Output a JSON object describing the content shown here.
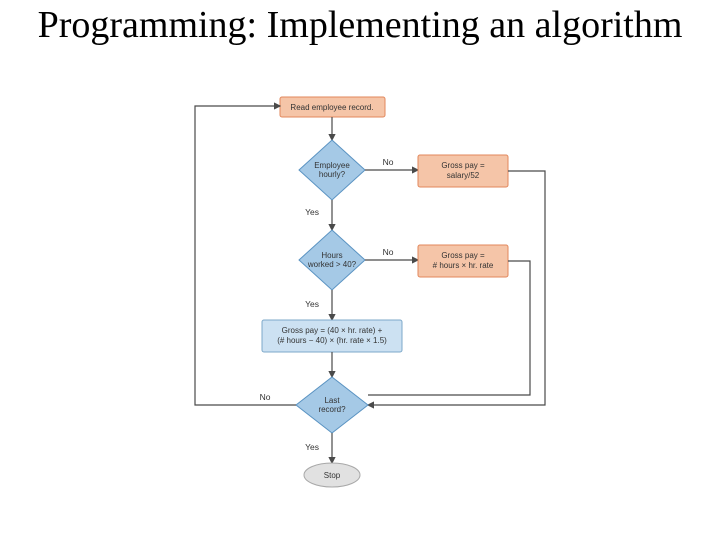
{
  "title": "Programming: Implementing an algorithm",
  "labels": {
    "yes": "Yes",
    "no": "No"
  },
  "nodes": {
    "read": "Read employee record.",
    "hourly_l1": "Employee",
    "hourly_l2": "hourly?",
    "salary_l1": "Gross pay =",
    "salary_l2": "salary/52",
    "hours40_l1": "Hours",
    "hours40_l2": "worked > 40?",
    "regpay_l1": "Gross pay =",
    "regpay_l2": "# hours × hr. rate",
    "ot_l1": "Gross pay = (40 × hr. rate) +",
    "ot_l2": "(# hours − 40) × (hr. rate × 1.5)",
    "last_l1": "Last",
    "last_l2": "record?",
    "stop": "Stop"
  }
}
